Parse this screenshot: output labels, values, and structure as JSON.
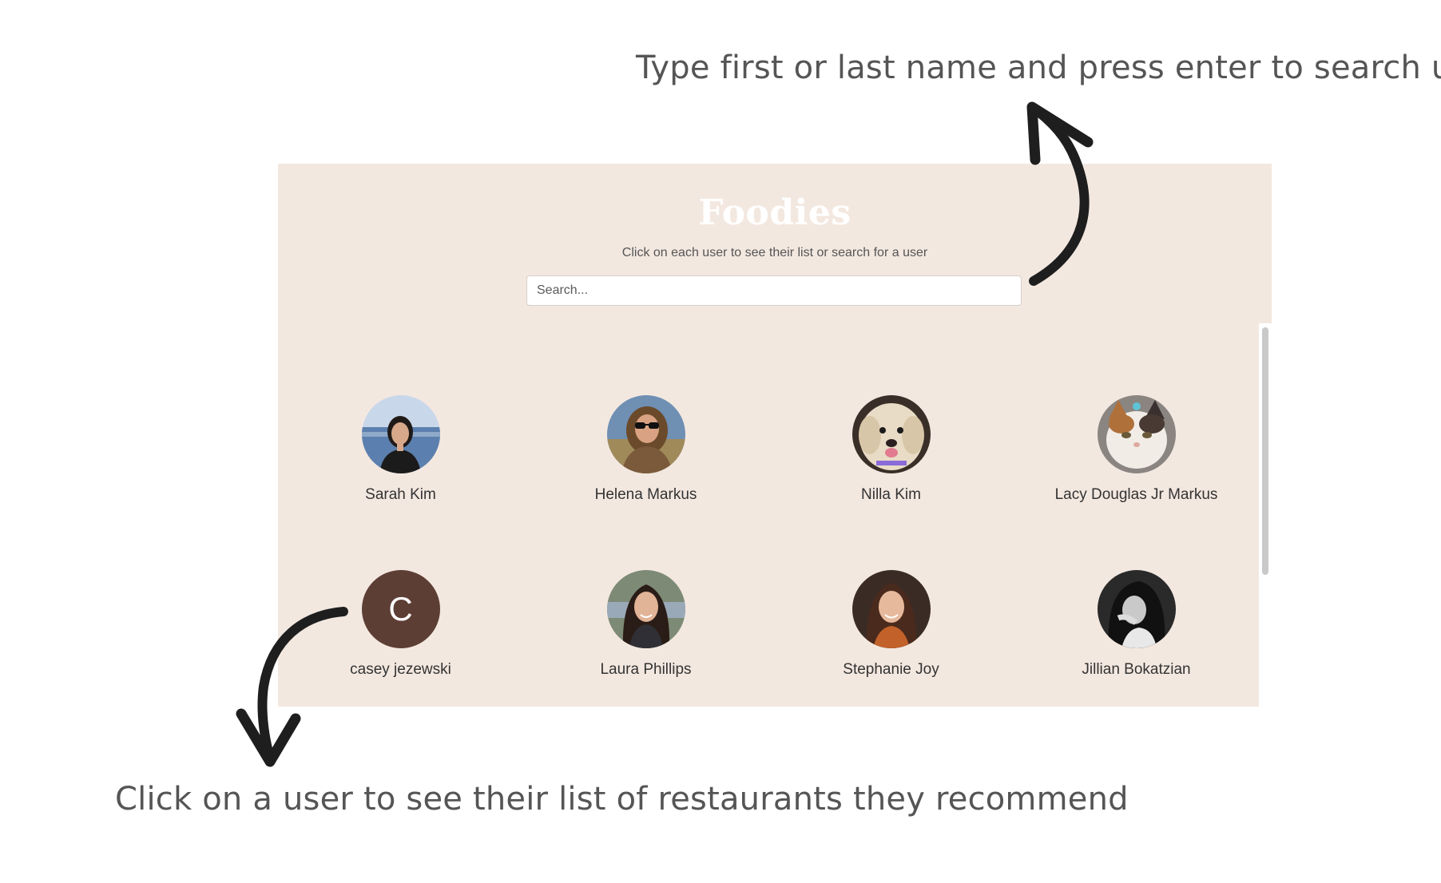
{
  "annotations": {
    "top": "Type first or last name and press enter to search user",
    "bottom": "Click on a user to see their list of restaurants they recommend"
  },
  "app": {
    "title": "Foodies",
    "subtitle": "Click on each user to see their list or search for a user",
    "search": {
      "placeholder": "Search...",
      "value": ""
    }
  },
  "colors": {
    "app_background": "#f3e8e0",
    "title_color": "#ffffff",
    "letter_avatar_background": "#5d3e35"
  },
  "users": [
    {
      "name": "Sarah Kim",
      "avatar": "photo-woman-lake",
      "letter": ""
    },
    {
      "name": "Helena Markus",
      "avatar": "photo-woman-sunglasses",
      "letter": ""
    },
    {
      "name": "Nilla Kim",
      "avatar": "photo-dog",
      "letter": ""
    },
    {
      "name": "Lacy Douglas Jr Markus",
      "avatar": "photo-cat",
      "letter": ""
    },
    {
      "name": "casey jezewski",
      "avatar": "letter-avatar",
      "letter": "C"
    },
    {
      "name": "Laura Phillips",
      "avatar": "photo-woman-dark-hair",
      "letter": ""
    },
    {
      "name": "Stephanie Joy",
      "avatar": "photo-woman-smiling",
      "letter": ""
    },
    {
      "name": "Jillian Bokatzian",
      "avatar": "photo-woman-bw",
      "letter": ""
    }
  ]
}
